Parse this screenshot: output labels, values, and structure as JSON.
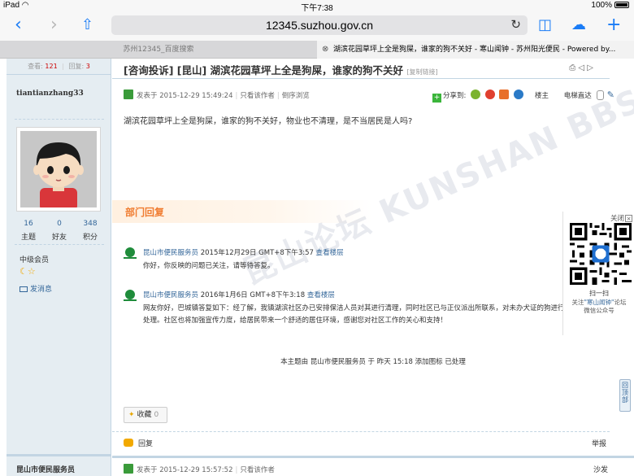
{
  "status_bar": {
    "device": "iPad",
    "time": "下午7:38",
    "battery": "100%"
  },
  "browser": {
    "url": "12345.suzhou.gov.cn",
    "tabs": [
      {
        "label": "苏州12345_百度搜索"
      },
      {
        "label": "湖滨花园草坪上全是狗屎，谁家的狗不关好 - 寒山闻钟 - 苏州阳光便民 - Powered by..."
      }
    ]
  },
  "sidebar": {
    "views_label": "查看:",
    "views": "121",
    "replies_label": "回复:",
    "replies": "3",
    "username": "tiantianzhang33",
    "stats": [
      {
        "value": "16",
        "label": "主题"
      },
      {
        "value": "0",
        "label": "好友"
      },
      {
        "value": "348",
        "label": "积分"
      }
    ],
    "level": "中级会员",
    "send_message": "发消息",
    "next_author": "昆山市便民服务员"
  },
  "thread": {
    "title": "[咨询投诉] [昆山] 湖滨花园草坪上全是狗屎，谁家的狗不关好",
    "copy_link": "[复制链接]",
    "posted_at": "发表于 2015-12-29 15:49:24",
    "only_author": "只看该作者",
    "reverse": "倒序浏览",
    "share_label": "分享到:",
    "floor_label": "楼主",
    "elevator_label": "电梯直达",
    "content": "湖滨花园草坪上全是狗屎，谁家的狗不关好，物业也不清理，是不当居民是人吗?",
    "dept_reply_title": "部门回复",
    "watermark": "昆山论坛 KUNSHAN BBS",
    "replies": [
      {
        "author": "昆山市便民服务员",
        "time": "2015年12月29日 GMT+8下午3:57",
        "view_floor": "查看楼层",
        "lines": [
          "你好，你反映的问题已关注，请等待答复。"
        ]
      },
      {
        "author": "昆山市便民服务员",
        "time": "2016年1月6日 GMT+8下午3:18",
        "view_floor": "查看楼层",
        "lines": [
          "网友你好，巴城镇答复如下：经了解，我镇湖滨社区办已安排保洁人员对其进行清理，同时社区已与正仪派出所联系，对未办犬证的狗进行",
          "处理。社区也将加强宣传力度，给居民带来一个舒适的居住环境，感谢您对社区工作的关心和支持！"
        ]
      }
    ],
    "moderation_notice": "本主题由 昆山市便民服务员 于 昨天 15:18 添加图标 已处理",
    "favorite_label": "收藏",
    "favorite_count": "0",
    "reply_label": "回复",
    "report_label": "举报",
    "second_post_time": "发表于 2015-12-29 15:57:52",
    "second_only_author": "只看该作者",
    "sofa_label": "沙发"
  },
  "qr_panel": {
    "close_label": "关闭",
    "scan_label": "扫一扫",
    "follow_prefix": "关注",
    "follow_name": "\"寒山闻钟\"",
    "follow_suffix": "论坛",
    "wechat_label": "微信公众号"
  },
  "back_to_top": "回顶部",
  "colors": {
    "accent": "#1a7cf6",
    "sidebar_bg": "#e5edf2",
    "border": "#c2d5e3",
    "link": "#336699",
    "dept_orange": "#f07c30"
  }
}
